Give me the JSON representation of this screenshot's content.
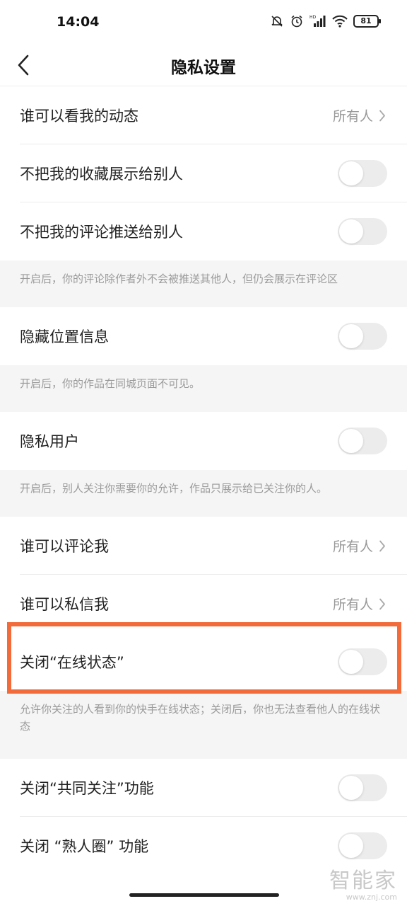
{
  "status": {
    "time": "14:04",
    "battery": "81",
    "icons": [
      "mute-icon",
      "alarm-icon",
      "hd-signal-icon",
      "wifi-icon",
      "battery-icon"
    ]
  },
  "header": {
    "title": "隐私设置",
    "back_icon": "chevron-left-icon"
  },
  "rows": {
    "who_can_see_feed": {
      "label": "谁可以看我的动态",
      "value": "所有人"
    },
    "hide_favorites": {
      "label": "不把我的收藏展示给别人",
      "on": false
    },
    "hide_comments": {
      "label": "不把我的评论推送给别人",
      "on": false
    },
    "hide_location": {
      "label": "隐藏位置信息",
      "on": false
    },
    "private_user": {
      "label": "隐私用户",
      "on": false
    },
    "who_can_comment": {
      "label": "谁可以评论我",
      "value": "所有人"
    },
    "who_can_message": {
      "label": "谁可以私信我",
      "value": "所有人"
    },
    "close_online_status": {
      "label": "关闭“在线状态”",
      "on": false
    },
    "close_mutual_follow": {
      "label": "关闭“共同关注”功能",
      "on": false
    },
    "close_acquaintance": {
      "label": "关闭 “熟人圈” 功能",
      "on": false
    }
  },
  "notes": {
    "comments": "开启后，你的评论除作者外不会被推送其他人，但仍会展示在评论区",
    "location": "开启后，你的作品在同城页面不可见。",
    "private": "开启后，别人关注你需要你的允许，作品只展示给已关注你的人。",
    "online": "允许你关注的人看到你的快手在线状态；关闭后，你也无法查看他人的在线状态"
  },
  "watermark": {
    "main": "智能家",
    "sub": "www.znj.com"
  },
  "colors": {
    "highlight": "#f26b3a",
    "toggle_off": "#ececec",
    "note_bg": "#f5f5f5"
  }
}
